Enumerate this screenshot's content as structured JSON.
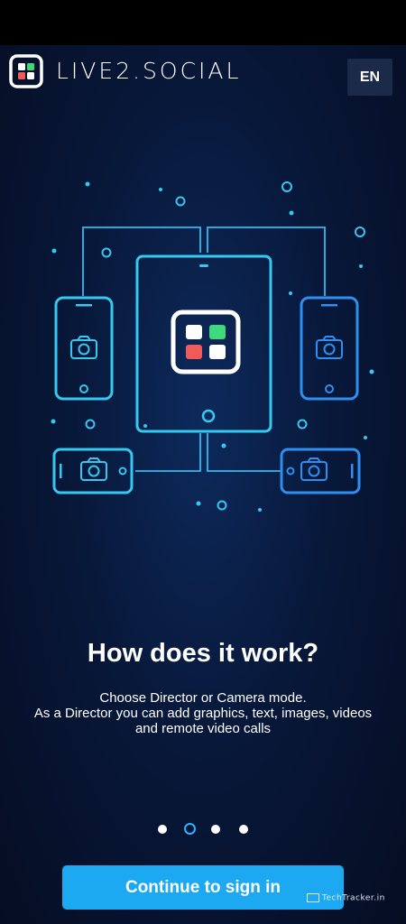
{
  "header": {
    "brand": "LIVE2.SOCIAL",
    "lang_button": "EN"
  },
  "onboarding": {
    "title": "How does it work?",
    "description_lines": [
      "Choose Director or Camera mode.",
      "As a Director you can add graphics, text, images, videos",
      "and remote video calls"
    ],
    "page_count": 4,
    "active_page": 2
  },
  "actions": {
    "continue_label": "Continue to sign in"
  },
  "watermark": "TechTracker.in",
  "colors": {
    "accent": "#1da8f2",
    "cyan": "#35c8f0",
    "blue": "#2e8ff0",
    "logo_green": "#3dd97a",
    "logo_red": "#f05a5a"
  },
  "icons": [
    "camera-icon",
    "app-logo-icon"
  ]
}
